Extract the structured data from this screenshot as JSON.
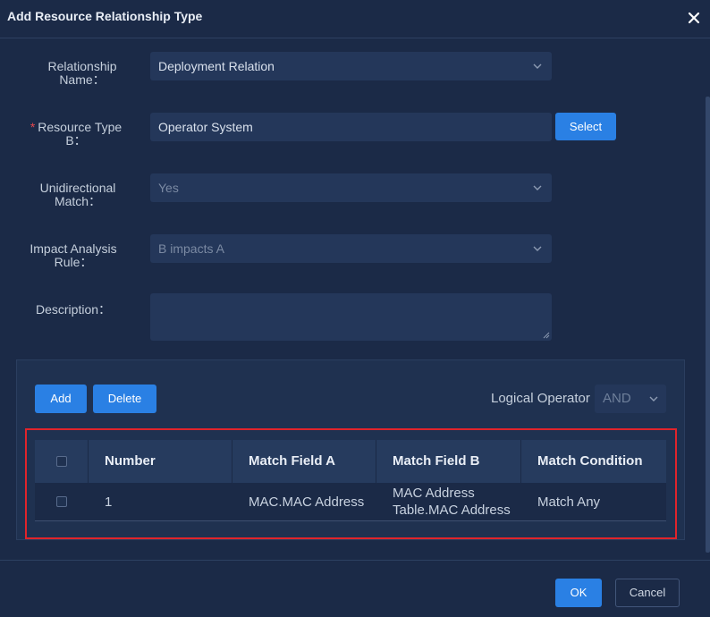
{
  "dialog": {
    "title": "Add Resource Relationship Type"
  },
  "form": {
    "relationship_name": {
      "label_line1": "Relationship",
      "label_line2": "Name：",
      "value": "Deployment Relation"
    },
    "resource_type_b": {
      "required_mark": "*",
      "label_line1": "Resource Type",
      "label_line2": "B：",
      "value": "Operator System",
      "select_label": "Select"
    },
    "unidirectional_match": {
      "label_line1": "Unidirectional",
      "label_line2": "Match：",
      "value": "Yes"
    },
    "impact_analysis_rule": {
      "label_line1": "Impact Analysis",
      "label_line2": "Rule：",
      "value": "B impacts A"
    },
    "description": {
      "label": "Description：",
      "value": ""
    }
  },
  "rules_panel": {
    "add_label": "Add",
    "delete_label": "Delete",
    "logical_operator_label": "Logical Operator",
    "logical_operator_value": "AND",
    "columns": [
      "Number",
      "Match Field A",
      "Match Field B",
      "Match Condition"
    ],
    "rows": [
      {
        "number": "1",
        "field_a": "MAC.MAC Address",
        "field_b_line1": "MAC Address",
        "field_b_line2": "Table.MAC Address",
        "condition": "Match Any"
      }
    ]
  },
  "footer": {
    "ok_label": "OK",
    "cancel_label": "Cancel"
  },
  "colors": {
    "background": "#1b2a47",
    "input_bg": "#24375a",
    "primary": "#2a80e4",
    "highlight_border": "#e0242b",
    "required": "#e5484d"
  },
  "icons": [
    "close-icon",
    "chevron-down-icon",
    "resize-grip-icon"
  ]
}
